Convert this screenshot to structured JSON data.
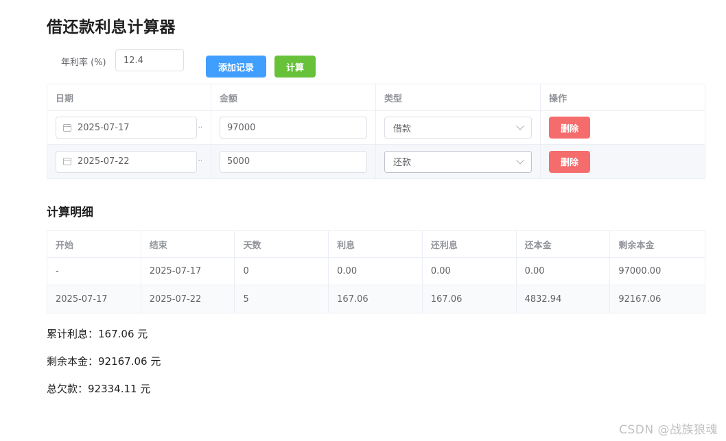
{
  "title": "借还款利息计算器",
  "rate": {
    "label": "年利率 (%)",
    "value": "12.4"
  },
  "buttons": {
    "add": "添加记录",
    "calc": "计算",
    "delete": "删除"
  },
  "records_table": {
    "headers": [
      "日期",
      "金额",
      "类型",
      "操作"
    ],
    "rows": [
      {
        "date": "2025-07-17",
        "amount": "97000",
        "type": "借款"
      },
      {
        "date": "2025-07-22",
        "amount": "5000",
        "type": "还款"
      }
    ]
  },
  "detail": {
    "title": "计算明细",
    "headers": [
      "开始",
      "结束",
      "天数",
      "利息",
      "还利息",
      "还本金",
      "剩余本金"
    ],
    "rows": [
      [
        "-",
        "2025-07-17",
        "0",
        "0.00",
        "0.00",
        "0.00",
        "97000.00"
      ],
      [
        "2025-07-17",
        "2025-07-22",
        "5",
        "167.06",
        "167.06",
        "4832.94",
        "92167.06"
      ]
    ]
  },
  "summary": {
    "interest": "累计利息：167.06 元",
    "principal": "剩余本金：92167.06 元",
    "owed": "总欠款：92334.11 元"
  },
  "watermark": "CSDN @战族狼魂",
  "icons": {
    "date": "calendar-icon",
    "select": "chevron-down-icon"
  },
  "colors": {
    "primary": "#409eff",
    "success": "#67c23a",
    "danger": "#f56c6c"
  }
}
